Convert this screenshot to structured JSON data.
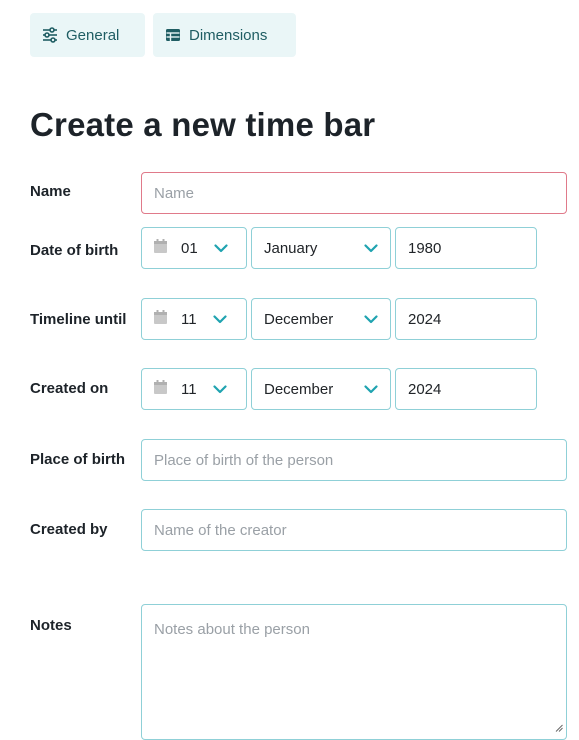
{
  "tabs": [
    {
      "label": "General",
      "icon": "sliders-icon"
    },
    {
      "label": "Dimensions",
      "icon": "table-icon"
    }
  ],
  "page_title": "Create a new time bar",
  "fields": {
    "name": {
      "label": "Name",
      "placeholder": "Name"
    },
    "date_of_birth": {
      "label": "Date of birth",
      "day": "01",
      "month": "January",
      "year": "1980"
    },
    "timeline_until": {
      "label": "Timeline until",
      "day": "11",
      "month": "December",
      "year": "2024"
    },
    "created_on": {
      "label": "Created on",
      "day": "11",
      "month": "December",
      "year": "2024"
    },
    "place_of_birth": {
      "label": "Place of birth",
      "placeholder": "Place of birth of the person"
    },
    "created_by": {
      "label": "Created by",
      "placeholder": "Name of the creator"
    },
    "notes": {
      "label": "Notes",
      "placeholder": "Notes about the person"
    }
  },
  "colors": {
    "accent": "#1fa3b0",
    "tab_bg": "#eaf6f7",
    "input_border": "#8fd0d7",
    "invalid_border": "#e07a8a"
  }
}
